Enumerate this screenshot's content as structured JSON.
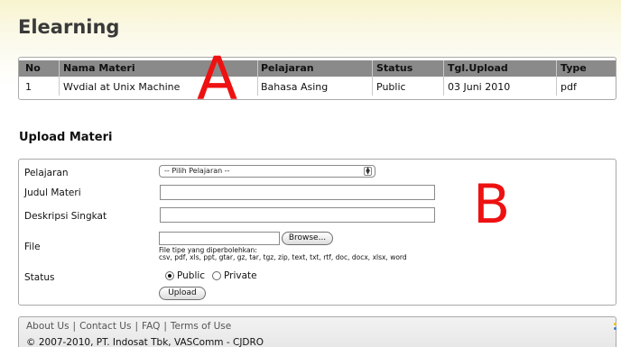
{
  "page": {
    "title": "Elearning"
  },
  "materials_table": {
    "headers": [
      "No",
      "Nama Materi",
      "Pelajaran",
      "Status",
      "Tgl.Upload",
      "Type"
    ],
    "rows": [
      [
        "1",
        "Wvdial at Unix Machine",
        "Bahasa Asing",
        "Public",
        "03 Juni 2010",
        "pdf"
      ]
    ]
  },
  "annotations": {
    "a": "A",
    "b": "B"
  },
  "upload_form": {
    "title": "Upload Materi",
    "labels": {
      "pelajaran": "Pelajaran",
      "judul": "Judul Materi",
      "deskripsi": "Deskripsi Singkat",
      "file": "File",
      "status": "Status"
    },
    "pelajaran_select": {
      "selected": "-- Pilih Pelajaran --"
    },
    "judul_value": "",
    "deskripsi_value": "",
    "browse_label": "Browse...",
    "file_hint_line1": "File tipe yang diperbolehkan:",
    "file_hint_line2": "csv, pdf, xls, ppt, gtar, gz, tar, tgz, zip, text, txt, rtf, doc, docx, xlsx, word",
    "status_options": [
      {
        "label": "Public",
        "checked": true
      },
      {
        "label": "Private",
        "checked": false
      }
    ],
    "upload_label": "Upload"
  },
  "footer": {
    "links": [
      "About Us",
      "Contact Us",
      "FAQ",
      "Terms of Use"
    ],
    "separator": "|",
    "copyright": "© 2007-2010, PT. Indosat Tbk, VASComm - CJDRO"
  },
  "colors": {
    "annotation": "#ee1111",
    "table_header": "#8a8a8a",
    "banner": "#f8f4cf"
  }
}
